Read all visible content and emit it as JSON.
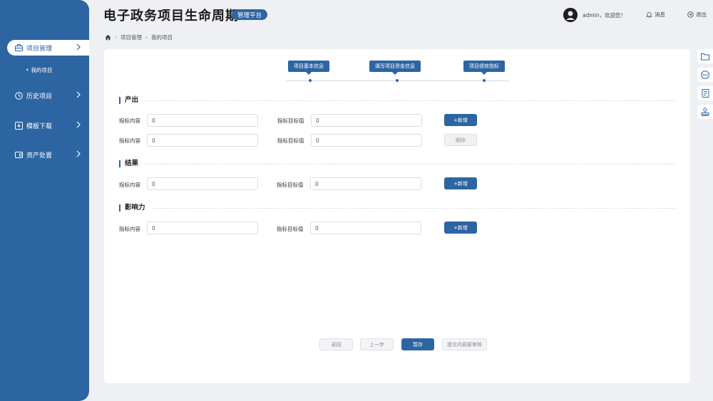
{
  "app": {
    "title": "电子政务项目生命周期",
    "badge": "管理平台"
  },
  "header": {
    "welcome": "admin，欢迎您！",
    "messages": "消息",
    "logout": "退出"
  },
  "breadcrumb": [
    "项目管理",
    "我的项目"
  ],
  "sidebar": {
    "items": [
      {
        "label": "项目管理",
        "icon": "briefcase-icon"
      },
      {
        "label": "历史项目",
        "icon": "clock-icon"
      },
      {
        "label": "模板下载",
        "icon": "download-icon"
      },
      {
        "label": "资产处置",
        "icon": "wallet-icon"
      }
    ],
    "sub_item": "我的项目"
  },
  "steps": [
    "项目基本信息",
    "填写项目资金信息",
    "项目绩效指标"
  ],
  "sections": [
    {
      "title": "产出",
      "rows": [
        {
          "content_label": "指标内容",
          "content_value": "0",
          "target_label": "指标目标值",
          "target_value": "0",
          "action": "+新增"
        },
        {
          "content_label": "指标内容",
          "content_value": "0",
          "target_label": "指标目标值",
          "target_value": "0",
          "action": "删除"
        }
      ]
    },
    {
      "title": "结果",
      "rows": [
        {
          "content_label": "指标内容",
          "content_value": "0",
          "target_label": "指标目标值",
          "target_value": "0",
          "action": "+新增"
        }
      ]
    },
    {
      "title": "影响力",
      "rows": [
        {
          "content_label": "指标内容",
          "content_value": "0",
          "target_label": "指标目标值",
          "target_value": "0",
          "action": "+新增"
        }
      ]
    }
  ],
  "footer_buttons": [
    "返回",
    "上一步",
    "暂存",
    "提交内容部审核"
  ],
  "right_tools": [
    "folder-icon",
    "more-icon",
    "document-icon",
    "stamp-icon"
  ],
  "colors": {
    "primary": "#2d65a2",
    "background": "#eef0f3"
  }
}
